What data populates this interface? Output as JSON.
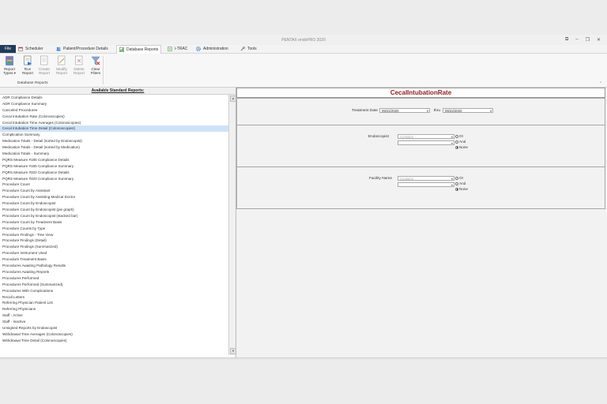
{
  "window": {
    "title": "PENTAX endoPRO 2020"
  },
  "menu": {
    "file": "File",
    "scheduler": "Scheduler",
    "patient": "Patient/Procedure Details",
    "database_reports": "Database Reports",
    "itrac": "i-TRAC",
    "administration": "Administration",
    "tools": "Tools"
  },
  "ribbon": {
    "report_types": "Report\nTypes ▾",
    "run_report": "Run\nReport",
    "create_report": "Create\nReport",
    "modify_report": "Modify\nReport",
    "delete_report": "Delete\nReport",
    "clear_filters": "Clear\nFilters",
    "group_label": "Database Reports"
  },
  "left_panel": {
    "header": "Available Standard Reports:",
    "selected_index": 5,
    "reports": [
      "ADR Compliance Details",
      "ADR Compliance Summary",
      "Canceled Procedures",
      "Cecal Intubation Rate (Colonoscopies)",
      "Cecal Intubation Time Averages (Colonoscopies)",
      "Cecal Intubation Time Detail (Colonoscopies)",
      "Complication Summary",
      "Medication Totals - Detail (sorted by Endoscopist)",
      "Medication Totals - Detail (sorted by Medication)",
      "Medication Totals - Summary",
      "PQRS Measure #185 Compliance Details",
      "PQRS Measure #185 Compliance Summary",
      "PQRS Measure #320 Compliance Details",
      "PQRS Measure #320 Compliance Summary",
      "Procedure Count",
      "Procedure Count by Assistant",
      "Procedure Count by Assisting Medical Doctor",
      "Procedure Count by Endoscopist",
      "Procedure Count by Endoscopist (pie graph)",
      "Procedure Count by Endoscopist (stacked bar)",
      "Procedure Count by Treatment Basis",
      "Procedure Counts by Type",
      "Procedure Findings - Tree View",
      "Procedure Findings (Detail)",
      "Procedure Findings (Summarized)",
      "Procedure Instrument Used",
      "Procedure Treatment Basis",
      "Procedures Awaiting Pathology Results",
      "Procedures Awaiting Reports",
      "Procedures Performed",
      "Procedures Performed (Summarized)",
      "Procedures With Complications",
      "Recall Letters",
      "Referring Physician Patient List",
      "Referring Physicians",
      "Staff - Active",
      "Staff - Inactive",
      "Unsigned Reports by Endoscopist",
      "Withdrawal Time Averages (Colonoscopies)",
      "Withdrawal Time Detail (Colonoscopies)"
    ]
  },
  "right_panel": {
    "title": "CecalIntubationRate",
    "treatment_date_label": "Treatment Date",
    "date_from": "09/22/2020",
    "thru_label": "thru",
    "date_to": "09/22/2020",
    "endoscopist": {
      "label": "Endoscopist",
      "match_placeholder": "Contains",
      "or": "Or",
      "and": "And",
      "none": "None"
    },
    "facility": {
      "label": "Facility Name",
      "match_placeholder": "Contains",
      "or": "Or",
      "and": "And",
      "none": "None"
    }
  },
  "colors": {
    "title_red": "#8b1c1c",
    "file_menu_bg": "#1f3b5a",
    "selection": "#cfe3f7"
  }
}
